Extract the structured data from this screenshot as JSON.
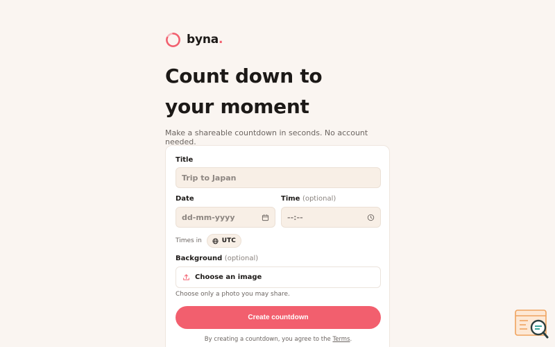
{
  "brand": {
    "name": "byna",
    "dot": ".",
    "accent_color": "#f25f6e",
    "logo_icon": "ring-logo-icon"
  },
  "hero": {
    "line1": "Count down to",
    "line2": "your moment",
    "subtitle": "Make a shareable countdown in seconds. No account needed."
  },
  "form": {
    "title_label": "Title",
    "title_placeholder": "Trip to Japan",
    "date_label": "Date",
    "date_placeholder": "dd-mm-yyyy",
    "date_icon": "calendar-icon",
    "time_label": "Time",
    "time_optional": "(optional)",
    "time_placeholder": "--:--",
    "time_icon": "clock-icon",
    "timezone_label": "Times in",
    "timezone_value": "UTC",
    "timezone_icon": "globe-icon",
    "background_label": "Background",
    "background_optional": "(optional)",
    "upload_label": "Choose an image",
    "upload_icon": "upload-icon",
    "upload_hint": "Choose only a photo you may share.",
    "submit_label": "Create countdown",
    "terms_prefix": "By creating a countdown, you agree to the",
    "terms_link": "Terms",
    "terms_suffix": "."
  },
  "widget": {
    "icon": "feedback-widget-icon"
  }
}
